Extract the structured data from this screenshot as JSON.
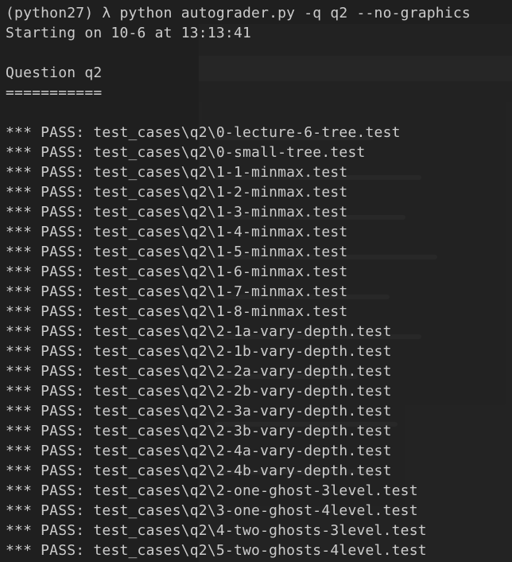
{
  "terminal": {
    "prompt_line": "(python27) λ python autograder.py -q q2 --no-graphics",
    "start_line": "Starting on 10-6 at 13:13:41",
    "blank1": "",
    "question_header": "Question q2",
    "question_underline": "===========",
    "blank2": "",
    "results": [
      "*** PASS: test_cases\\q2\\0-lecture-6-tree.test",
      "*** PASS: test_cases\\q2\\0-small-tree.test",
      "*** PASS: test_cases\\q2\\1-1-minmax.test",
      "*** PASS: test_cases\\q2\\1-2-minmax.test",
      "*** PASS: test_cases\\q2\\1-3-minmax.test",
      "*** PASS: test_cases\\q2\\1-4-minmax.test",
      "*** PASS: test_cases\\q2\\1-5-minmax.test",
      "*** PASS: test_cases\\q2\\1-6-minmax.test",
      "*** PASS: test_cases\\q2\\1-7-minmax.test",
      "*** PASS: test_cases\\q2\\1-8-minmax.test",
      "*** PASS: test_cases\\q2\\2-1a-vary-depth.test",
      "*** PASS: test_cases\\q2\\2-1b-vary-depth.test",
      "*** PASS: test_cases\\q2\\2-2a-vary-depth.test",
      "*** PASS: test_cases\\q2\\2-2b-vary-depth.test",
      "*** PASS: test_cases\\q2\\2-3a-vary-depth.test",
      "*** PASS: test_cases\\q2\\2-3b-vary-depth.test",
      "*** PASS: test_cases\\q2\\2-4a-vary-depth.test",
      "*** PASS: test_cases\\q2\\2-4b-vary-depth.test",
      "*** PASS: test_cases\\q2\\2-one-ghost-3level.test",
      "*** PASS: test_cases\\q2\\3-one-ghost-4level.test",
      "*** PASS: test_cases\\q2\\4-two-ghosts-3level.test",
      "*** PASS: test_cases\\q2\\5-two-ghosts-4level.test"
    ]
  },
  "colors": {
    "background": "#1f1f1f",
    "text": "#cccccc"
  }
}
